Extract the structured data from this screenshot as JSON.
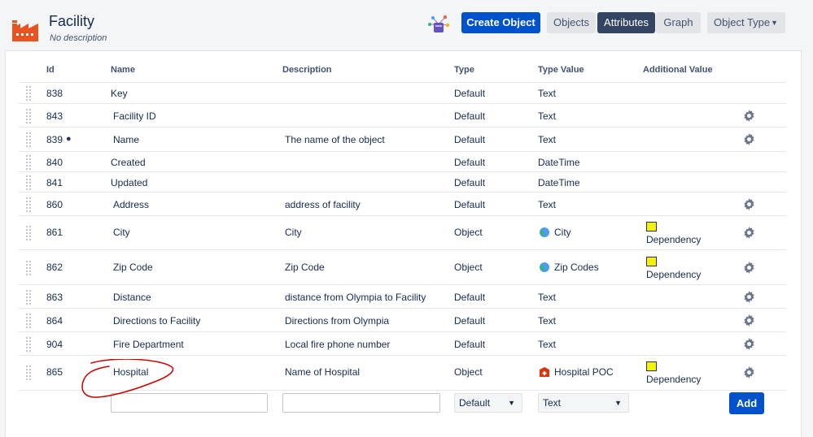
{
  "header": {
    "title": "Facility",
    "subtitle": "No description",
    "create_button": "Create Object",
    "tabs": [
      "Objects",
      "Attributes",
      "Graph"
    ],
    "active_tab": "Attributes",
    "object_type_button": "Object Type"
  },
  "columns": [
    "Id",
    "Name",
    "Description",
    "Type",
    "Type Value",
    "Additional Value"
  ],
  "rows": [
    {
      "id": "838",
      "name": "Key",
      "description": "",
      "type": "Default",
      "type_value": "Text",
      "additional": "",
      "gear": false,
      "tag": false,
      "tv_icon": ""
    },
    {
      "id": "843",
      "name": "Facility ID",
      "description": "",
      "type": "Default",
      "type_value": "Text",
      "additional": "",
      "gear": true,
      "tag": false,
      "tv_icon": ""
    },
    {
      "id": "839",
      "name": "Name",
      "description": "The name of the object",
      "type": "Default",
      "type_value": "Text",
      "additional": "",
      "gear": true,
      "tag": true,
      "tv_icon": ""
    },
    {
      "id": "840",
      "name": "Created",
      "description": "",
      "type": "Default",
      "type_value": "DateTime",
      "additional": "",
      "gear": false,
      "tag": false,
      "tv_icon": ""
    },
    {
      "id": "841",
      "name": "Updated",
      "description": "",
      "type": "Default",
      "type_value": "DateTime",
      "additional": "",
      "gear": false,
      "tag": false,
      "tv_icon": ""
    },
    {
      "id": "860",
      "name": "Address",
      "description": "address of facility",
      "type": "Default",
      "type_value": "Text",
      "additional": "",
      "gear": true,
      "tag": false,
      "tv_icon": ""
    },
    {
      "id": "861",
      "name": "City",
      "description": "City",
      "type": "Object",
      "type_value": "City",
      "additional": "Dependency",
      "gear": true,
      "tag": false,
      "tv_icon": "globe-icon"
    },
    {
      "id": "862",
      "name": "Zip Code",
      "description": "Zip Code",
      "type": "Object",
      "type_value": "Zip Codes",
      "additional": "Dependency",
      "gear": true,
      "tag": false,
      "tv_icon": "globe-icon"
    },
    {
      "id": "863",
      "name": "Distance",
      "description": "distance from Olympia to Facility",
      "type": "Default",
      "type_value": "Text",
      "additional": "",
      "gear": true,
      "tag": false,
      "tv_icon": ""
    },
    {
      "id": "864",
      "name": "Directions to Facility",
      "description": "Directions from Olympia",
      "type": "Default",
      "type_value": "Text",
      "additional": "",
      "gear": true,
      "tag": false,
      "tv_icon": ""
    },
    {
      "id": "904",
      "name": "Fire Department",
      "description": "Local fire phone number",
      "type": "Default",
      "type_value": "Text",
      "additional": "",
      "gear": true,
      "tag": false,
      "tv_icon": ""
    },
    {
      "id": "865",
      "name": "Hospital",
      "description": "Name of Hospital",
      "type": "Object",
      "type_value": "Hospital POC",
      "additional": "Dependency",
      "gear": true,
      "tag": false,
      "tv_icon": "hospital-icon"
    }
  ],
  "new_row": {
    "name_value": "",
    "description_value": "",
    "type_select": "Default",
    "type_value_select": "Text",
    "add_button": "Add"
  },
  "colors": {
    "primary": "#0052cc",
    "active_tab": "#344563",
    "dependency_swatch": "#f2f20b",
    "annotation": "#cc0000",
    "logo": "#e8531f"
  }
}
